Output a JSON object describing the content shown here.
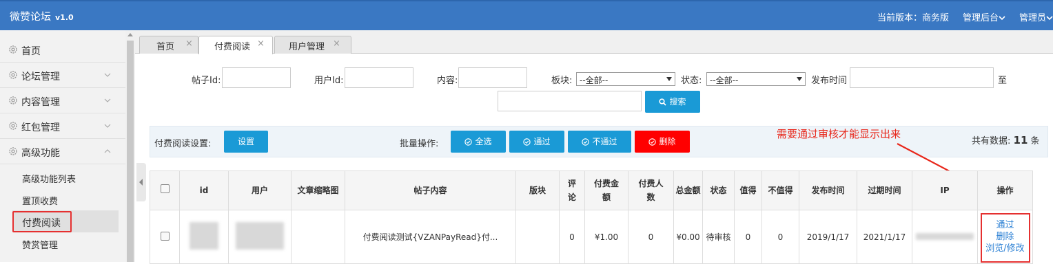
{
  "app": {
    "title": "微赞论坛",
    "version": "v1.0"
  },
  "topbar": {
    "edition": "当前版本：商务版",
    "admin_backend": "管理后台",
    "admin_user": "管理员"
  },
  "sidebar": {
    "items": [
      {
        "label": "首页",
        "icon": "gear-icon",
        "chevron": ""
      },
      {
        "label": "论坛管理",
        "icon": "gear-icon",
        "chevron": "chevron-down-icon"
      },
      {
        "label": "内容管理",
        "icon": "gear-icon",
        "chevron": "chevron-down-icon"
      },
      {
        "label": "红包管理",
        "icon": "gear-icon",
        "chevron": "chevron-down-icon"
      },
      {
        "label": "高级功能",
        "icon": "gear-icon",
        "chevron": "chevron-up-icon"
      }
    ],
    "subitems": [
      "高级功能列表",
      "置顶收费",
      "付费阅读",
      "赞赏管理"
    ],
    "active_subitem": "付费阅读"
  },
  "tabs": [
    {
      "label": "首页",
      "close": "×"
    },
    {
      "label": "付费阅读",
      "close": "×",
      "active": true
    },
    {
      "label": "用户管理",
      "close": "×"
    }
  ],
  "filters": {
    "post_id_label": "帖子Id:",
    "user_id_label": "用户Id:",
    "content_label": "内容:",
    "section_label": "板块:",
    "section_value": "--全部--",
    "status_label": "状态:",
    "status_value": "--全部--",
    "publish_time_label": "发布时间",
    "to_label": "至",
    "search_button": "搜索"
  },
  "ops": {
    "settings_label": "付费阅读设置:",
    "settings_button": "设置",
    "batch_label": "批量操作:",
    "select_all": "全选",
    "approve": "通过",
    "reject": "不通过",
    "delete": "删除",
    "total_prefix": "共有数据:",
    "total_count": "11",
    "total_suffix": "条"
  },
  "annotation": "需要通过审核才能显示出来",
  "table": {
    "headers": [
      "",
      "id",
      "用户",
      "文章缩略图",
      "帖子内容",
      "版块",
      "评论",
      "付费金额",
      "付费人数",
      "总金额",
      "状态",
      "值得",
      "不值得",
      "发布时间",
      "过期时间",
      "IP",
      "操作"
    ],
    "rows": [
      {
        "id": "",
        "user": "",
        "thumbnail": "",
        "content": "付费阅读测试{VZANPayRead}付...",
        "section": "",
        "comments": "0",
        "pay_amount": "¥1.00",
        "payers": "0",
        "total": "¥0.00",
        "status": "待审核",
        "worth": "0",
        "not_worth": "0",
        "publish_time": "2019/1/17",
        "expire_time": "2021/1/17",
        "ip": "",
        "actions": [
          "通过",
          "删除",
          "浏览/修改"
        ]
      }
    ]
  },
  "colors": {
    "topbar": "#3a78c3",
    "button_blue": "#1a9ad6",
    "button_red": "#ff0000",
    "annotation": "#e8261a"
  }
}
